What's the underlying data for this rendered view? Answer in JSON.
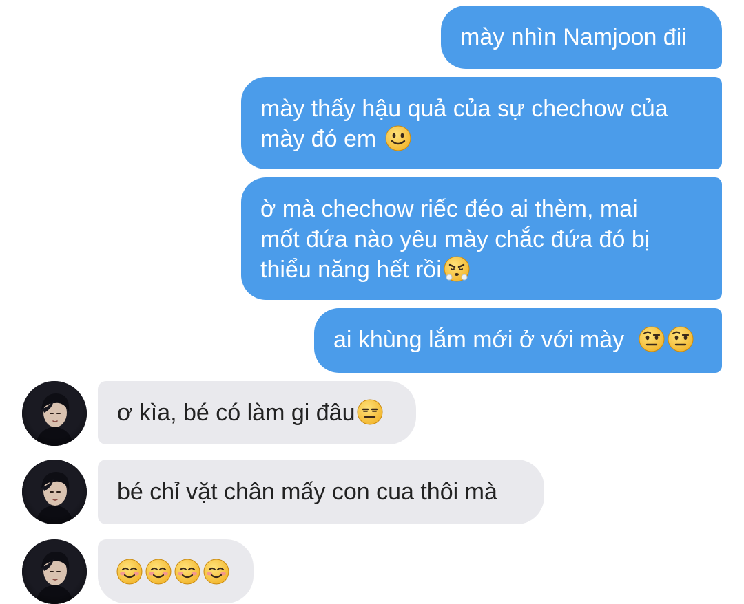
{
  "conversation": {
    "messages": [
      {
        "sender": "me",
        "text": "mày nhìn Namjoon đii",
        "emoji": []
      },
      {
        "sender": "me",
        "lines": [
          "mày thấy hậu quả của sự chechow của",
          "mày đó em"
        ],
        "emoji": [
          "slightly-smiling-face"
        ]
      },
      {
        "sender": "me",
        "lines": [
          "ờ mà chechow riếc đéo ai thèm, mai",
          "mốt đứa nào yêu mày chắc đứa đó bị",
          "thiểu năng hết rồi"
        ],
        "emoji": [
          "face-with-steam-from-nose"
        ]
      },
      {
        "sender": "me",
        "text": "ai khùng lắm mới ở với mày",
        "emoji": [
          "face-with-raised-eyebrow",
          "face-with-raised-eyebrow"
        ]
      },
      {
        "sender": "them",
        "text": "ơ kìa, bé có làm gi đâu",
        "emoji": [
          "expressionless-face"
        ]
      },
      {
        "sender": "them",
        "text": "bé chỉ vặt chân mấy con cua thôi mà",
        "emoji": []
      },
      {
        "sender": "them",
        "text": "",
        "emoji": [
          "smiling-face",
          "smiling-face",
          "smiling-face",
          "smiling-face"
        ]
      }
    ]
  },
  "colors": {
    "outgoing_bubble": "#4b9cea",
    "incoming_bubble": "#e9e9ed",
    "outgoing_text": "#ffffff",
    "incoming_text": "#222222"
  }
}
